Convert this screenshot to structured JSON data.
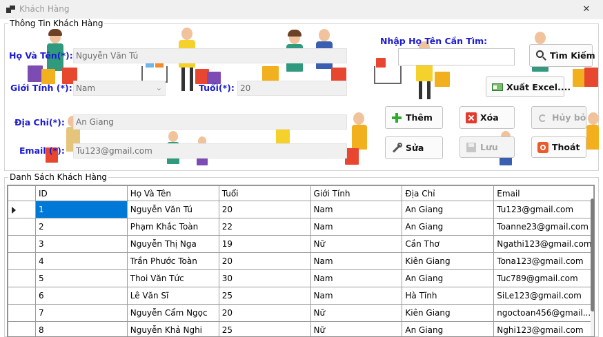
{
  "window": {
    "title": "Khách Hàng",
    "close_label": "✕"
  },
  "info_group": {
    "legend": "Thông Tin Khách Hàng",
    "name_label": "Họ Và Tên(*):",
    "name_value": "Nguyễn Văn Tú",
    "gender_label": "Giới Tính (*):",
    "gender_value": "Nam",
    "age_label": "Tuổi(*):",
    "age_value": "20",
    "address_label": "Địa Chỉ(*):",
    "address_value": "An Giang",
    "email_label": "Email (*):",
    "email_value": "Tu123@gmail.com",
    "search_label": "Nhập Họ Tên Cần Tìm:",
    "search_value": ""
  },
  "buttons": {
    "search": "Tìm Kiếm",
    "export": "Xuất Excel....",
    "add": "Thêm",
    "delete": "Xóa",
    "cancel": "Hủy bỏ",
    "edit": "Sửa",
    "save": "Lưu",
    "exit": "Thoát"
  },
  "colors": {
    "label_blue": "#1b1bcf",
    "selection": "#0078d7"
  },
  "list_group": {
    "legend": "Danh Sách Khách Hàng",
    "columns": [
      "ID",
      "Họ Và Tên",
      "Tuổi",
      "Giới Tính",
      "Địa Chỉ",
      "Email"
    ],
    "rows": [
      [
        "1",
        "Nguyễn Văn Tú",
        "20",
        "Nam",
        "An Giang",
        "Tu123@gmail.com"
      ],
      [
        "2",
        "Phạm Khắc Toàn",
        "22",
        "Nam",
        "An Giang",
        "Toanne23@gmail.com"
      ],
      [
        "3",
        "Nguyễn Thị Nga",
        "19",
        "Nữ",
        "Cần Thơ",
        "Ngathi123@gmail.com"
      ],
      [
        "4",
        "Trần Phước Toàn",
        "20",
        "Nam",
        "Kiên Giang",
        "Tona123@gmail.com"
      ],
      [
        "5",
        "Thoi Văn Tức",
        "30",
        "Nam",
        "An Giang",
        "Tuc789@gmail.com"
      ],
      [
        "6",
        "Lê Văn Sĩ",
        "25",
        "Nam",
        "Hà Tĩnh",
        "SiLe123@gmail.com"
      ],
      [
        "7",
        "Nguyễn Cẩm Ngọc",
        "20",
        "Nữ",
        "Kiên Giang",
        "ngoctoan456@gmail...."
      ],
      [
        "8",
        "Nguyễn Khả Nghi",
        "25",
        "Nữ",
        "An Giang",
        "Nghi123@gmail.com"
      ]
    ]
  }
}
